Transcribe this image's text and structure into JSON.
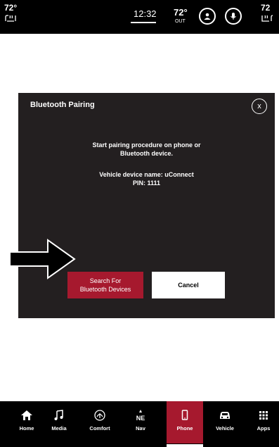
{
  "status": {
    "temp_left": "72°",
    "time": "12:32",
    "outside_temp": "72°",
    "outside_label": "OUT",
    "temp_right": "72"
  },
  "dialog": {
    "title": "Bluetooth Pairing",
    "close_label": "x",
    "message_line1": "Start pairing procedure on phone or",
    "message_line2": "Bluetooth device.",
    "device_name": "Vehicle device name: uConnect",
    "pin": "PIN: 1111",
    "search_line1": "Search For",
    "search_line2": "Bluetooth Devices",
    "cancel_label": "Cancel"
  },
  "nav": {
    "items": [
      {
        "label": "Home",
        "icon": "home-icon"
      },
      {
        "label": "Media",
        "icon": "music-icon"
      },
      {
        "label": "Comfort",
        "icon": "comfort-icon"
      },
      {
        "label": "Nav",
        "icon": "compass-icon",
        "badge": "NE"
      },
      {
        "label": "Phone",
        "icon": "phone-icon",
        "active": true
      },
      {
        "label": "Vehicle",
        "icon": "car-icon"
      },
      {
        "label": "Apps",
        "icon": "grid-icon"
      }
    ]
  },
  "colors": {
    "accent": "#a6192e",
    "dialog_bg": "#231f20",
    "frame": "#6fd2d9"
  }
}
